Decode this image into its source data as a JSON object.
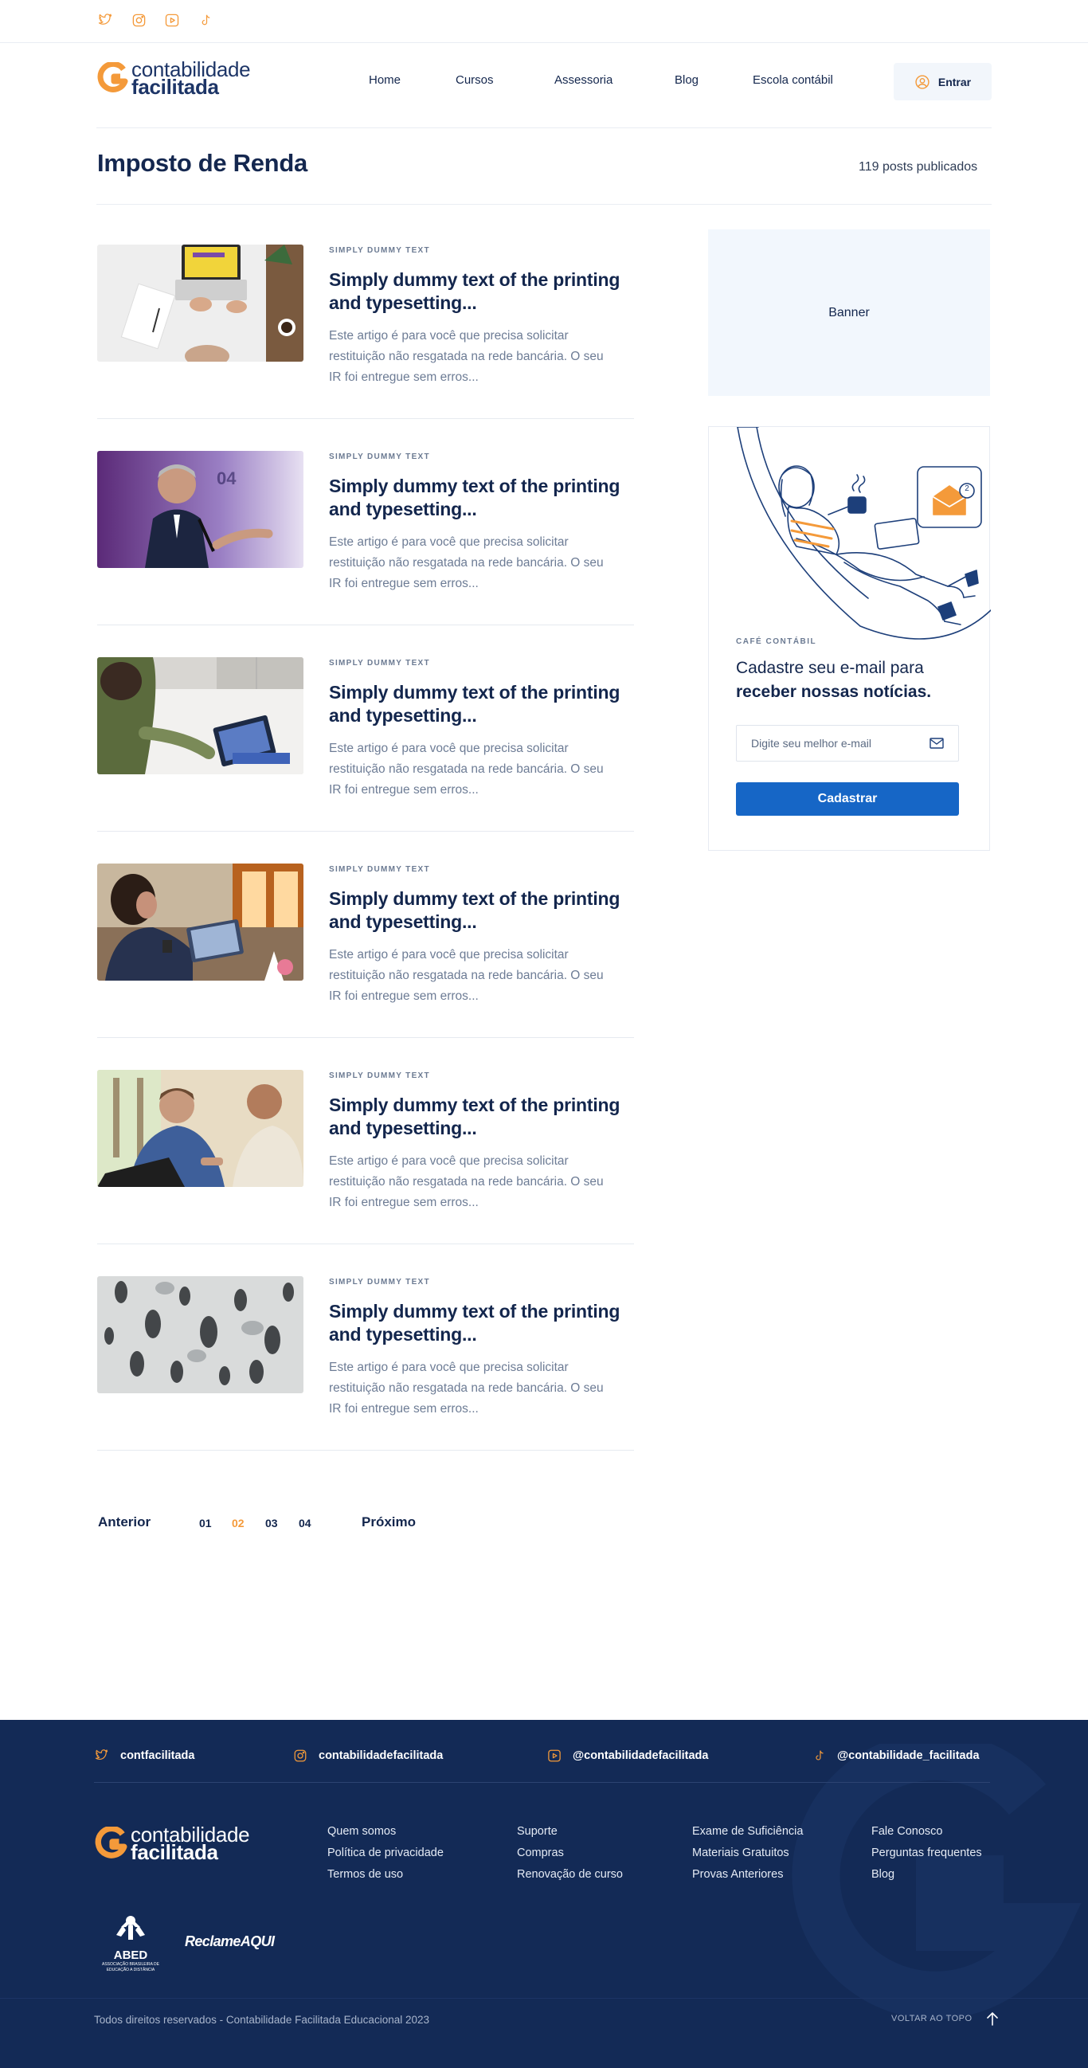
{
  "top_social": [
    {
      "icon": "twitter-icon"
    },
    {
      "icon": "instagram-icon"
    },
    {
      "icon": "youtube-icon"
    },
    {
      "icon": "tiktok-icon"
    }
  ],
  "brand": {
    "line1": "contabilidade",
    "line2": "facilitada",
    "accent": "#f49a3a",
    "navy": "#1d3567"
  },
  "nav": {
    "home": "Home",
    "cursos": "Cursos",
    "assessoria": "Assessoria",
    "blog": "Blog",
    "escola": "Escola contábil",
    "login": "Entrar"
  },
  "page": {
    "title": "Imposto de Renda",
    "count": "119 posts publicados"
  },
  "posts": [
    {
      "category": "SIMPLY DUMMY TEXT",
      "title": "Simply dummy text of the printing and typesetting...",
      "excerpt": "Este artigo é para você que precisa solicitar restituição não resgatada na rede bancária. O seu IR foi entregue sem erros..."
    },
    {
      "category": "SIMPLY DUMMY TEXT",
      "title": "Simply dummy text of the printing and typesetting...",
      "excerpt": "Este artigo é para você que precisa solicitar restituição não resgatada na rede bancária. O seu IR foi entregue sem erros..."
    },
    {
      "category": "SIMPLY DUMMY TEXT",
      "title": "Simply dummy text of the printing and typesetting...",
      "excerpt": "Este artigo é para você que precisa solicitar restituição não resgatada na rede bancária. O seu IR foi entregue sem erros..."
    },
    {
      "category": "SIMPLY DUMMY TEXT",
      "title": "Simply dummy text of the printing and typesetting...",
      "excerpt": "Este artigo é para você que precisa solicitar restituição não resgatada na rede bancária. O seu IR foi entregue sem erros..."
    },
    {
      "category": "SIMPLY DUMMY TEXT",
      "title": "Simply dummy text of the printing and typesetting...",
      "excerpt": "Este artigo é para você que precisa solicitar restituição não resgatada na rede bancária. O seu IR foi entregue sem erros..."
    },
    {
      "category": "SIMPLY DUMMY TEXT",
      "title": "Simply dummy text of the printing and typesetting...",
      "excerpt": "Este artigo é para você que precisa solicitar restituição não resgatada na rede bancária. O seu IR foi entregue sem erros..."
    }
  ],
  "pagination": {
    "prev": "Anterior",
    "pages": [
      "01",
      "02",
      "03",
      "04"
    ],
    "active": "02",
    "next": "Próximo"
  },
  "sidebar": {
    "banner": "Banner",
    "newsletter": {
      "eyebrow": "CAFÉ CONTÁBIL",
      "title_plain": "Cadastre seu e-mail para",
      "title_bold": "receber nossas notícias.",
      "placeholder": "Digite seu melhor e-mail",
      "button": "Cadastrar",
      "badge": "2"
    }
  },
  "footer": {
    "social": [
      {
        "icon": "twitter-icon",
        "handle": "contfacilitada"
      },
      {
        "icon": "instagram-icon",
        "handle": "contabilidadefacilitada"
      },
      {
        "icon": "youtube-icon",
        "handle": "@contabilidadefacilitada"
      },
      {
        "icon": "tiktok-icon",
        "handle": "@contabilidade_facilitada"
      }
    ],
    "columns": [
      [
        "Quem somos",
        "Política de privacidade",
        "Termos de uso"
      ],
      [
        "Suporte",
        "Compras",
        "Renovação de curso"
      ],
      [
        "Exame de Suficiência",
        "Materiais Gratuitos",
        "Provas Anteriores"
      ],
      [
        "Fale Conosco",
        "Perguntas frequentes",
        "Blog"
      ]
    ],
    "abed": {
      "name": "ABED",
      "subtitle": "ASSOCIAÇÃO BRASILEIRA DE EDUCAÇÃO A DISTÂNCIA"
    },
    "reclame": "ReclameAQUI",
    "copyright": "Todos direitos reservados - Contabilidade Facilitada Educacional 2023",
    "back_to_top": "VOLTAR AO TOPO",
    "bg": "#132a56"
  }
}
